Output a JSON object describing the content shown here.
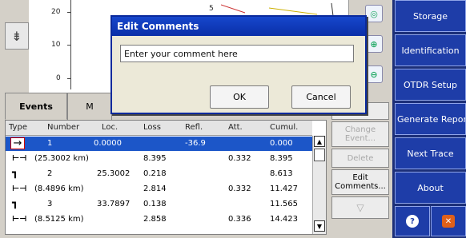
{
  "graph": {
    "y_ticks": [
      "20",
      "10",
      "0"
    ],
    "top_label": "5"
  },
  "left_tool_icon": "trace-marker-icon",
  "zoom_buttons": [
    "zoom-fit-icon",
    "zoom-in-icon",
    "zoom-out-icon"
  ],
  "right_menu": {
    "items": [
      "Storage",
      "Identification",
      "OTDR Setup",
      "Generate Repor",
      "Next Trace",
      "About"
    ],
    "help_icon": "help-icon",
    "close_icon": "close-icon"
  },
  "tabs": {
    "events": "Events",
    "second": "M"
  },
  "table": {
    "headers": [
      "Type",
      "Number",
      "Loc.",
      "Loss",
      "Refl.",
      "Att.",
      "Cumul."
    ],
    "rows": [
      {
        "type_icon": "launch-event-icon",
        "number": "1",
        "loc": "0.0000",
        "loss": "",
        "refl": "-36.9",
        "att": "",
        "cumul": "0.000",
        "selected": true
      },
      {
        "type_icon": "fiber-section-icon",
        "number": "(25.3002 km)",
        "loc": "",
        "loss": "8.395",
        "refl": "",
        "att": "0.332",
        "cumul": "8.395",
        "selected": false
      },
      {
        "type_icon": "splice-event-icon",
        "number": "2",
        "loc": "25.3002",
        "loss": "0.218",
        "refl": "",
        "att": "",
        "cumul": "8.613",
        "selected": false
      },
      {
        "type_icon": "fiber-section-icon",
        "number": "(8.4896 km)",
        "loc": "",
        "loss": "2.814",
        "refl": "",
        "att": "0.332",
        "cumul": "11.427",
        "selected": false
      },
      {
        "type_icon": "splice-event-icon",
        "number": "3",
        "loc": "33.7897",
        "loss": "0.138",
        "refl": "",
        "att": "",
        "cumul": "11.565",
        "selected": false
      },
      {
        "type_icon": "fiber-section-icon",
        "number": "(8.5125 km)",
        "loc": "",
        "loss": "2.858",
        "refl": "",
        "att": "0.336",
        "cumul": "14.423",
        "selected": false
      }
    ]
  },
  "actions": {
    "change_event": "Change Event...",
    "delete": "Delete",
    "edit_comments": "Edit Comments..."
  },
  "dialog": {
    "title": "Edit Comments",
    "input_value": "Enter your comment here",
    "ok_label": "OK",
    "cancel_label": "Cancel"
  }
}
